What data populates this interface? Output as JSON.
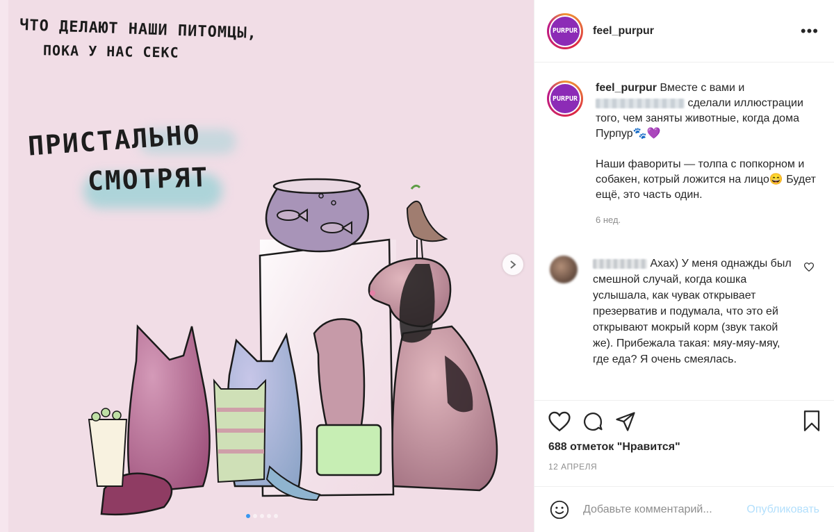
{
  "media": {
    "caption_line1": "ЧТО ДЕЛАЮТ НАШИ ПИТОМЦЫ,",
    "caption_line2": "ПОКА У НАС СЕКС",
    "big_word1": "ПРИСТАЛЬНО",
    "big_word2": "СМОТРЯТ",
    "carousel_dots": 5,
    "active_dot": 1
  },
  "header": {
    "username": "feel_purpur",
    "avatar_text": "PURPUR"
  },
  "caption": {
    "username": "feel_purpur",
    "line1_before": "Вместе с вами и",
    "line1_after": "сделали иллюстрации того, чем заняты животные, когда дома Пурпур",
    "emoji": "🐾💜",
    "paragraph2": "Наши фавориты — толпа с попкорном и собакен, котрый ложится на лицо😄 Будет ещё, это часть один.",
    "time": "6 нед."
  },
  "comment": {
    "text": "Ахах) У меня однажды был смешной случай, когда кошка услышала, как чувак открывает презерватив и подумала, что это ей открывают мокрый корм (звук такой же). Прибежала такая: мяу-мяу-мяу, где еда? Я очень смеялась."
  },
  "stats": {
    "likes": "688 отметок \"Нравится\"",
    "date": "12 АПРЕЛЯ"
  },
  "comment_bar": {
    "placeholder": "Добавьте комментарий...",
    "post_label": "Опубликовать"
  },
  "colors": {
    "brand_purple": "#8c2bb6",
    "post_button_disabled": "#b2dffc",
    "media_bg": "#f1dde6"
  }
}
